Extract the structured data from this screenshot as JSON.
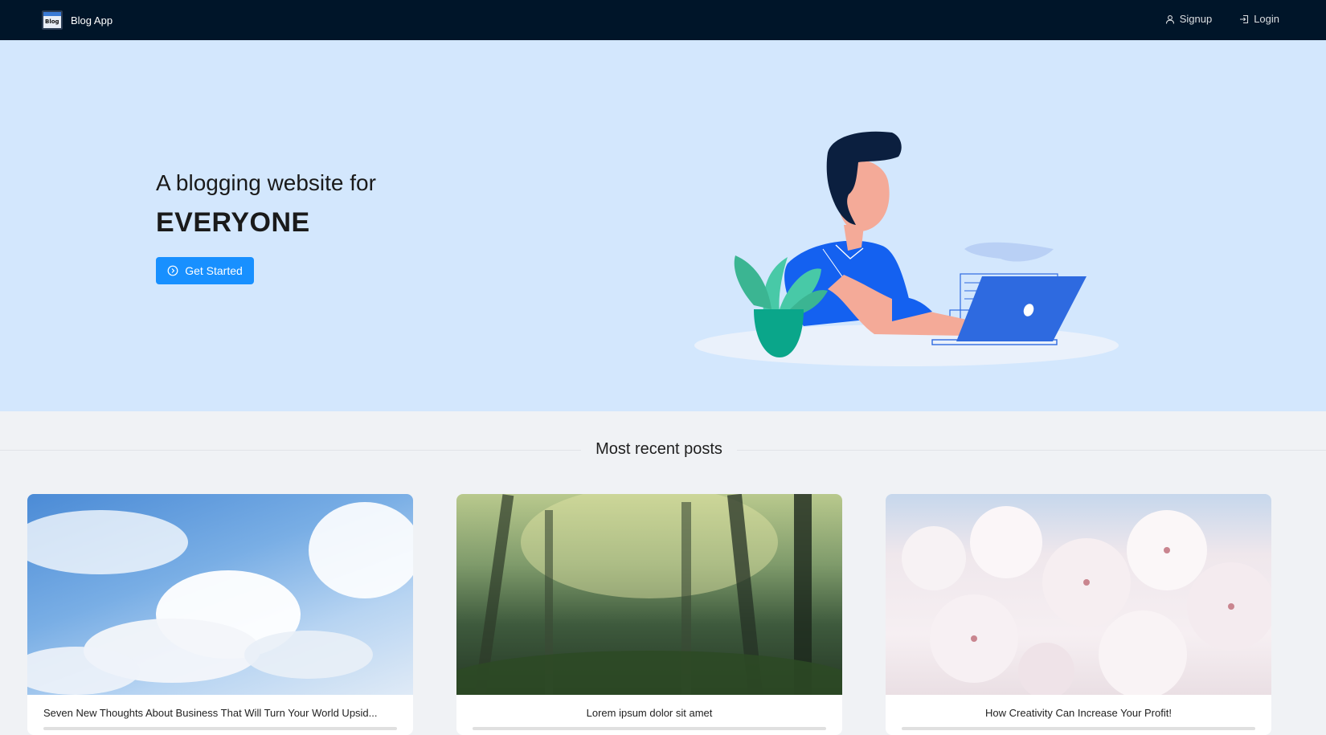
{
  "header": {
    "brand_logo_text": "Blog",
    "brand_name": "Blog App",
    "nav": [
      {
        "label": "Signup",
        "icon": "user-icon"
      },
      {
        "label": "Login",
        "icon": "login-icon"
      }
    ]
  },
  "hero": {
    "line1": "A blogging website for",
    "line2": "EVERYONE",
    "cta_label": "Get Started",
    "cta_icon": "arrow-circle-right-icon",
    "illustration": "person-with-laptop-illustration"
  },
  "section": {
    "title": "Most recent posts"
  },
  "posts": [
    {
      "title": "Seven New Thoughts About Business That Will Turn Your World Upsid...",
      "image": "blue-sky-clouds"
    },
    {
      "title": "Lorem ipsum dolor sit amet",
      "image": "misty-forest"
    },
    {
      "title": "How Creativity Can Increase Your Profit!",
      "image": "cherry-blossoms"
    }
  ],
  "colors": {
    "header_bg": "#001529",
    "hero_bg": "#d3e7fd",
    "primary": "#1890ff",
    "page_bg": "#f0f2f5"
  }
}
